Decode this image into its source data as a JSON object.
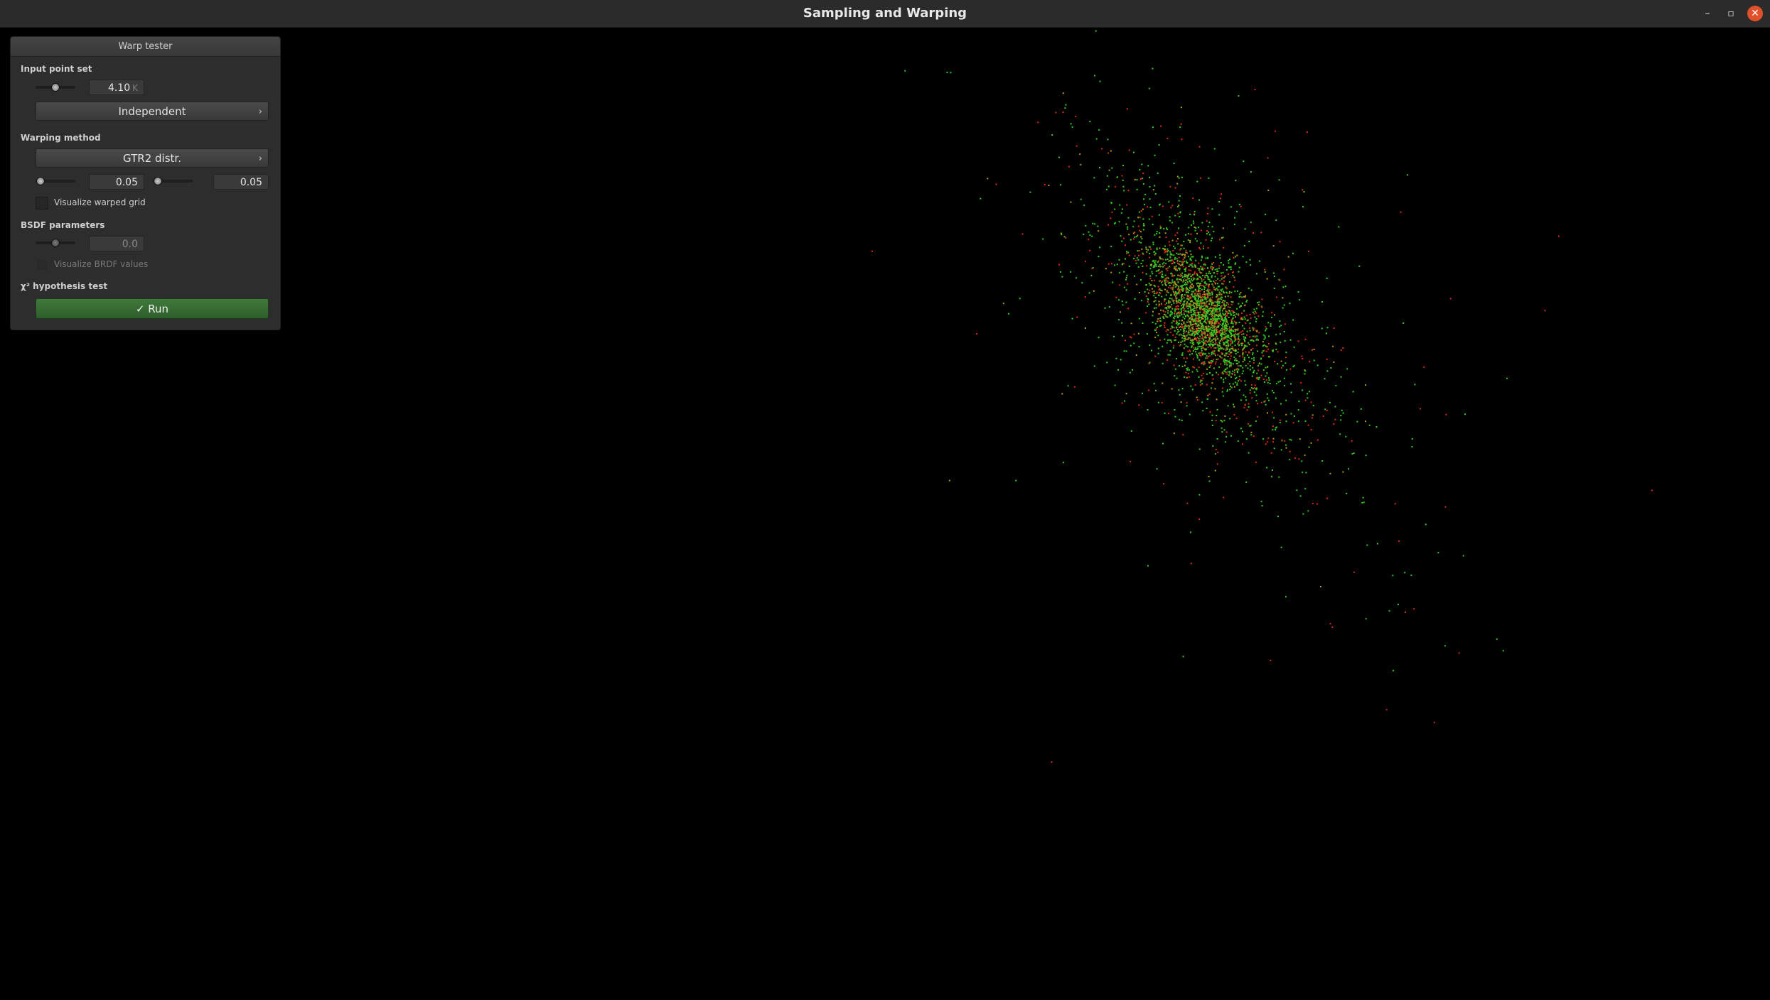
{
  "window": {
    "title": "Sampling and Warping",
    "controls": {
      "minimize": "–",
      "maximize": "▫",
      "close": "✕"
    }
  },
  "panel": {
    "title": "Warp tester",
    "input_point_set": {
      "label": "Input point set",
      "count_value": "4.10",
      "count_unit": "K",
      "slider_level": 0.5,
      "method": "Independent"
    },
    "warping_method": {
      "label": "Warping method",
      "method": "GTR2 distr.",
      "param1_value": "0.05",
      "param2_value": "0.05",
      "param1_level": 0.05,
      "param2_level": 0.05,
      "visualize_grid_label": "Visualize warped grid",
      "visualize_grid_checked": false
    },
    "bsdf_parameters": {
      "label": "BSDF parameters",
      "value": "0.0",
      "slider_level": 0.5,
      "visualize_brdf_label": "Visualize BRDF values",
      "visualize_brdf_checked": false
    },
    "hypothesis_test": {
      "label": "χ² hypothesis test",
      "run_label": "✓ Run"
    }
  },
  "colors": {
    "sample_green": "#33cc22",
    "sample_red": "#dd2a1a",
    "sample_yellow": "#b89a1c",
    "background": "#000000"
  }
}
